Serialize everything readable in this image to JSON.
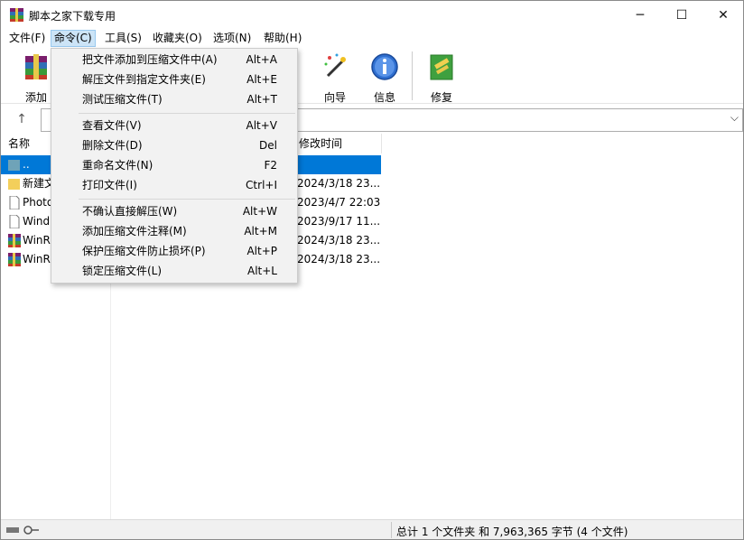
{
  "window": {
    "title": "脚本之家下载专用",
    "min_icon": "─",
    "max_icon": "☐",
    "close_icon": "✕"
  },
  "menubar": {
    "items": [
      "文件(F)",
      "命令(C)",
      "工具(S)",
      "收藏夹(O)",
      "选项(N)",
      "帮助(H)"
    ]
  },
  "toolbar": {
    "add_label": "添加",
    "wizard_label": "向导",
    "info_label": "信息",
    "repair_label": "修复"
  },
  "columns": {
    "name": "名称",
    "modified": "修改时间"
  },
  "files": [
    {
      "name": "..",
      "date": "",
      "icon": "parent-folder-icon"
    },
    {
      "name": "新建文",
      "date": "2024/3/18 23...",
      "icon": "folder-icon"
    },
    {
      "name": "Photo",
      "date": "2023/4/7 22:03",
      "icon": "document-icon"
    },
    {
      "name": "Wind",
      "date": "2023/9/17 11...",
      "icon": "document-icon"
    },
    {
      "name": "WinR",
      "date": "2024/3/18 23...",
      "icon": "winrar-archive-icon"
    },
    {
      "name": "WinR",
      "date": "2024/3/18 23...",
      "icon": "winrar-archive-icon"
    }
  ],
  "command_menu": {
    "groups": [
      [
        {
          "label": "把文件添加到压缩文件中(A)",
          "shortcut": "Alt+A"
        },
        {
          "label": "解压文件到指定文件夹(E)",
          "shortcut": "Alt+E"
        },
        {
          "label": "测试压缩文件(T)",
          "shortcut": "Alt+T"
        }
      ],
      [
        {
          "label": "查看文件(V)",
          "shortcut": "Alt+V"
        },
        {
          "label": "删除文件(D)",
          "shortcut": "Del"
        },
        {
          "label": "重命名文件(N)",
          "shortcut": "F2"
        },
        {
          "label": "打印文件(I)",
          "shortcut": "Ctrl+I"
        }
      ],
      [
        {
          "label": "不确认直接解压(W)",
          "shortcut": "Alt+W"
        },
        {
          "label": "添加压缩文件注释(M)",
          "shortcut": "Alt+M"
        },
        {
          "label": "保护压缩文件防止损坏(P)",
          "shortcut": "Alt+P"
        },
        {
          "label": "锁定压缩文件(L)",
          "shortcut": "Alt+L"
        }
      ]
    ]
  },
  "status": {
    "summary": "总计 1 个文件夹 和 7,963,365 字节 (4 个文件)"
  },
  "colors": {
    "selection": "#0078d7",
    "menu_highlight": "#cce4f7"
  }
}
